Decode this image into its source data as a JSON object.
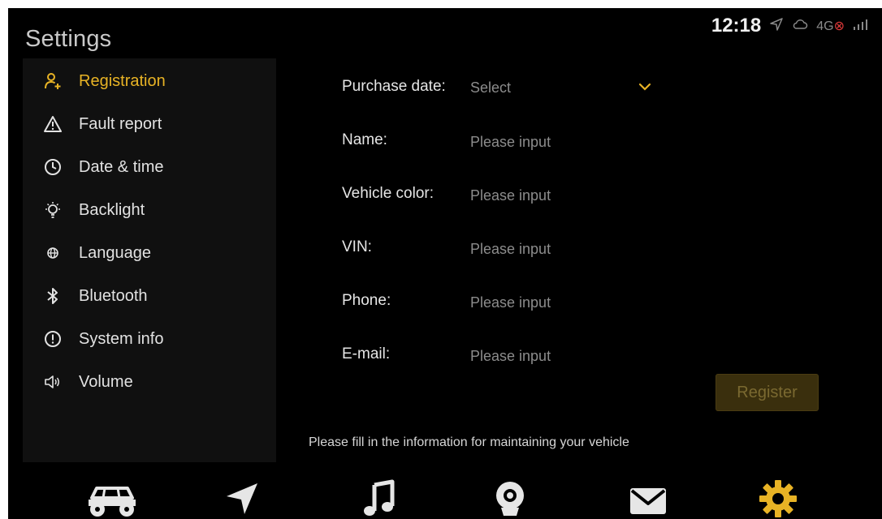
{
  "app": {
    "title": "Settings"
  },
  "status_bar": {
    "time": "12:18",
    "network": "4G",
    "network_badge": "⊗"
  },
  "sidebar": {
    "items": [
      {
        "label": "Registration",
        "icon": "person-add-icon",
        "active": true
      },
      {
        "label": "Fault report",
        "icon": "warning-triangle-icon",
        "active": false
      },
      {
        "label": "Date & time",
        "icon": "clock-icon",
        "active": false
      },
      {
        "label": "Backlight",
        "icon": "lightbulb-icon",
        "active": false
      },
      {
        "label": "Language",
        "icon": "globe-icon",
        "active": false
      },
      {
        "label": "Bluetooth",
        "icon": "bluetooth-icon",
        "active": false
      },
      {
        "label": "System info",
        "icon": "info-circle-icon",
        "active": false
      },
      {
        "label": "Volume",
        "icon": "speaker-icon",
        "active": false
      }
    ]
  },
  "form": {
    "purchase_date": {
      "label": "Purchase date:",
      "value": "Select"
    },
    "name": {
      "label": "Name:",
      "placeholder": "Please input",
      "value": ""
    },
    "vehicle_color": {
      "label": "Vehicle color:",
      "placeholder": "Please input",
      "value": ""
    },
    "vin": {
      "label": "VIN:",
      "placeholder": "Please input",
      "value": ""
    },
    "phone": {
      "label": "Phone:",
      "placeholder": "Please input",
      "value": ""
    },
    "email": {
      "label": "E-mail:",
      "placeholder": "Please input",
      "value": ""
    },
    "register_label": "Register",
    "hint": "Please fill in the information for maintaining your vehicle"
  },
  "dock": {
    "items": [
      {
        "icon": "utv-vehicle-icon",
        "active": false
      },
      {
        "icon": "navigation-arrow-icon",
        "active": false
      },
      {
        "icon": "music-note-icon",
        "active": false
      },
      {
        "icon": "camera-lens-icon",
        "active": false
      },
      {
        "icon": "mail-envelope-icon",
        "active": false
      },
      {
        "icon": "settings-gear-icon",
        "active": true
      }
    ]
  },
  "colors": {
    "accent": "#e8b325",
    "background": "#000000",
    "sidebar": "#101010",
    "text": "#e2e2e2",
    "muted": "#8c8c8c",
    "register_bg": "#3a2f0d"
  }
}
